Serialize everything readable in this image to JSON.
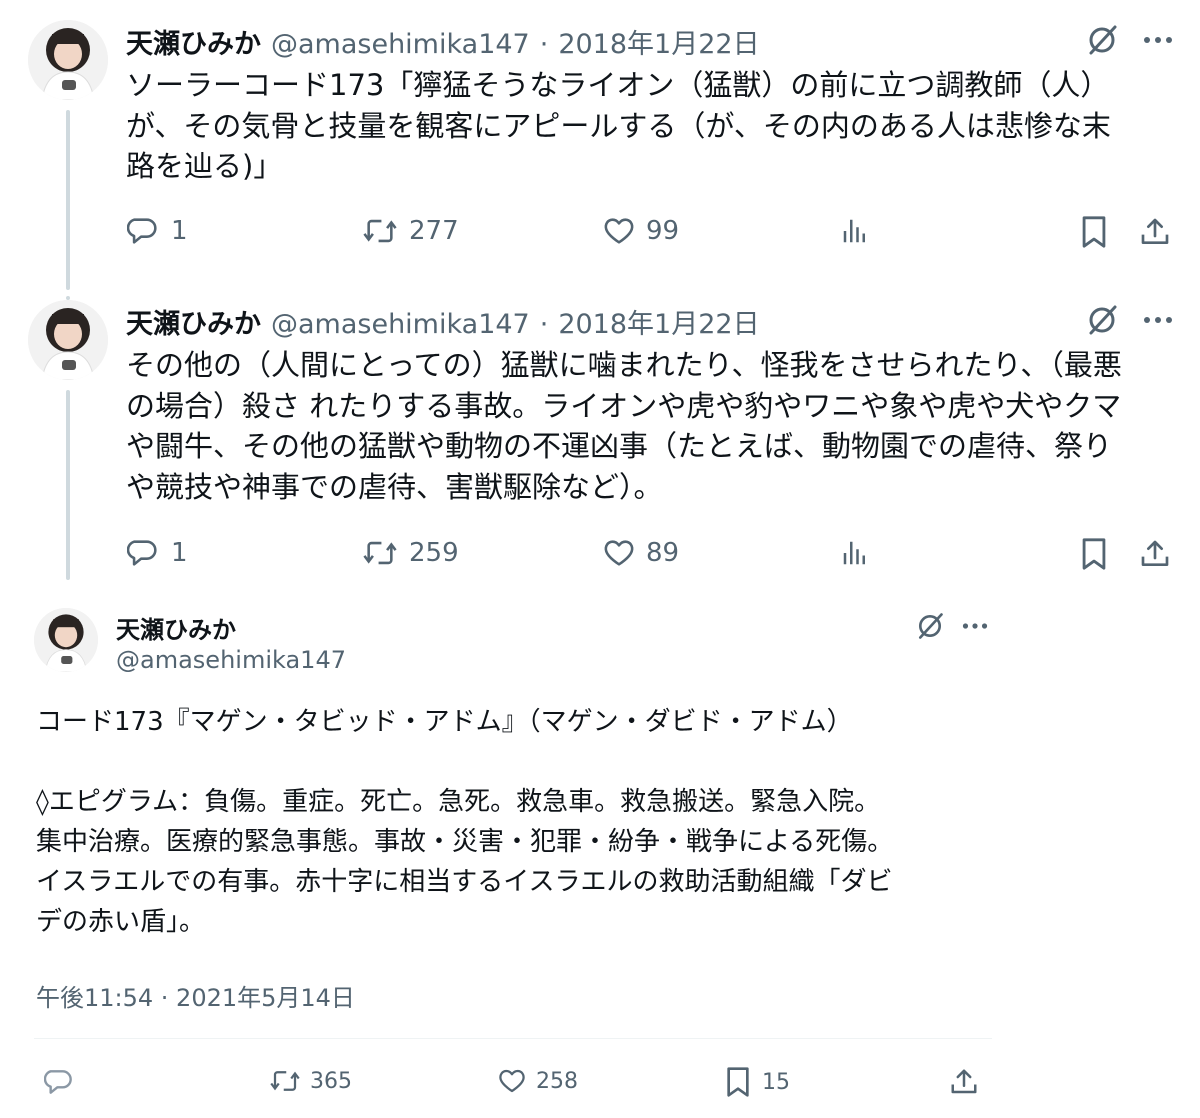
{
  "tweets": [
    {
      "name": "天瀬ひみか",
      "handle": "@amasehimika147",
      "sep": "·",
      "date": "2018年1月22日",
      "text": "ソーラーコード173「獰猛そうなライオン（猛獣）の前に立つ調教師（人）\nが、その気骨と技量を観客にアピールする（が、その内のある人は悲惨な末\n路を辿る)」",
      "reply_count": "1",
      "retweet_count": "277",
      "like_count": "99"
    },
    {
      "name": "天瀬ひみか",
      "handle": "@amasehimika147",
      "sep": "·",
      "date": "2018年1月22日",
      "text": "その他の（人間にとっての）猛獣に噛まれたり、怪我をさせられたり、（最悪\nの場合）殺さ れたりする事故。ライオンや虎や豹やワニや象や虎や犬やクマ\nや闘牛、その他の猛獣や動物の不運凶事（たとえば、動物園での虐待、祭り\nや競技や神事での虐待、害獣駆除など）。",
      "reply_count": "1",
      "retweet_count": "259",
      "like_count": "89"
    }
  ],
  "main_tweet": {
    "name": "天瀬ひみか",
    "handle": "@amasehimika147",
    "text": "コード173『マゲン・タビッド・アドム』（マゲン・ダビド・アドム）\n\n◊エピグラム：負傷。重症。死亡。急死。救急車。救急搬送。緊急入院。\n集中治療。医療的緊急事態。事故・災害・犯罪・紛争・戦争による死傷。\nイスラエルでの有事。赤十字に相当するイスラエルの救助活動組織「ダビ\nデの赤い盾」。",
    "timestamp": "午後11:54 · 2021年5月14日",
    "retweet_count": "365",
    "like_count": "258",
    "bookmark_count": "15"
  },
  "colors": {
    "text": "#0f1419",
    "secondary": "#536471",
    "thread_line": "#cfd9de",
    "divider": "#eff3f4"
  },
  "icons": [
    "grok-icon",
    "more-icon",
    "reply-icon",
    "retweet-icon",
    "like-icon",
    "views-icon",
    "bookmark-icon",
    "share-icon"
  ]
}
